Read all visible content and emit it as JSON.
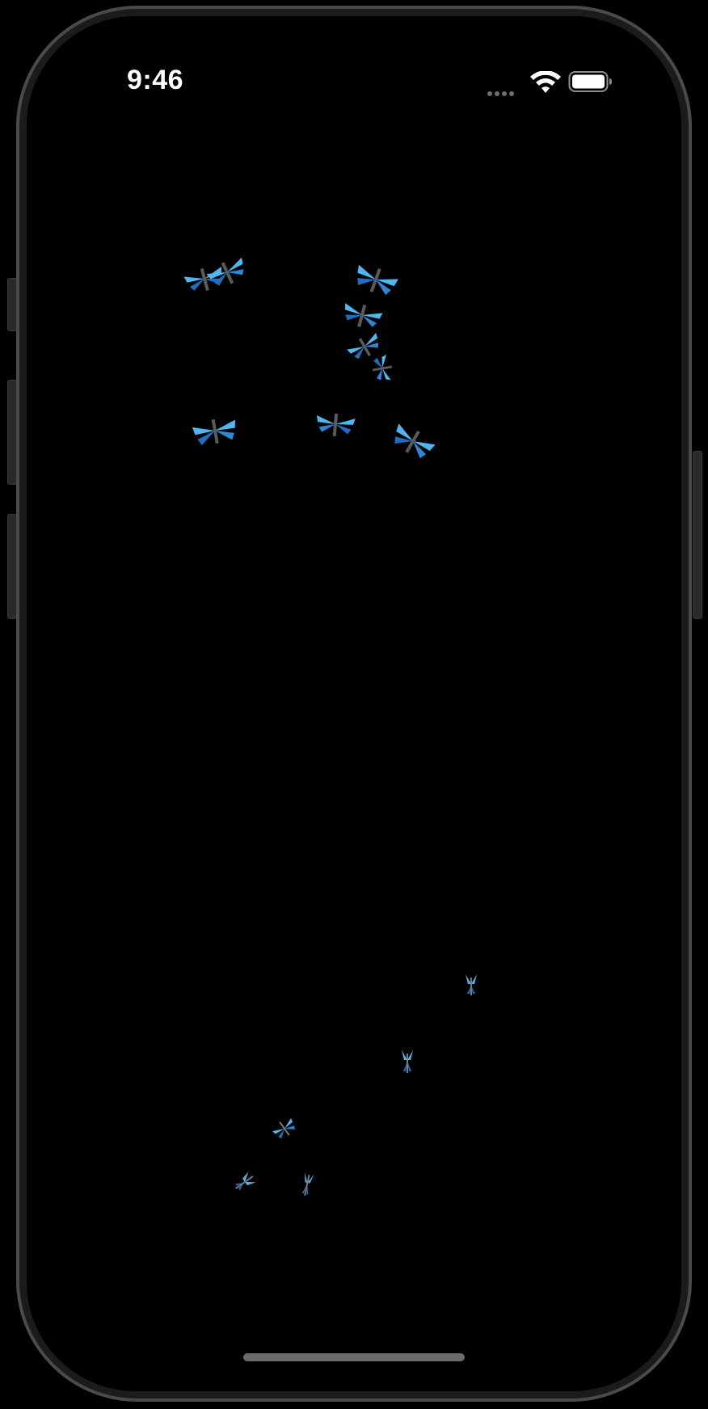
{
  "status_bar": {
    "time": "9:46",
    "signal_icon": "cellular-dots-icon",
    "wifi_icon": "wifi-icon",
    "battery_icon": "battery-full-icon"
  },
  "scene": {
    "background_color": "#000000",
    "insect_color_light": "#4fb7f0",
    "insect_color_dark": "#1f6fc0",
    "insect_body_color": "#5a5a5a",
    "insect_icon": "dragonfly-icon"
  },
  "home_indicator": {
    "icon": "home-indicator-bar"
  }
}
